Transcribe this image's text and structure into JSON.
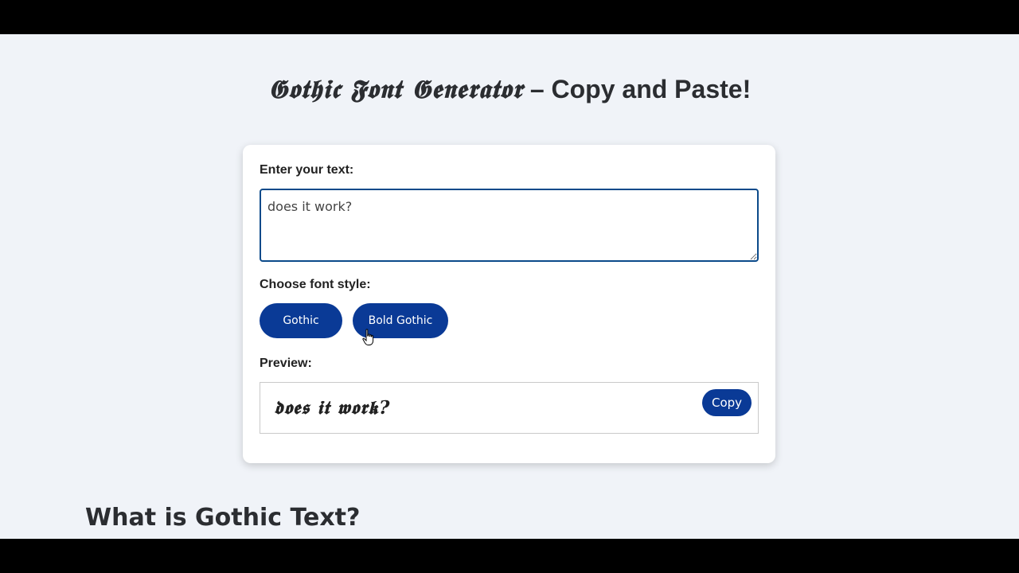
{
  "page": {
    "title_gothic": "𝕲𝖔𝖙𝖍𝖎𝖈 𝕱𝖔𝖓𝖙 𝕲𝖊𝖓𝖊𝖗𝖆𝖙𝖔𝖗",
    "title_rest": " – Copy and Paste!",
    "section_heading": "What is Gothic Text?"
  },
  "form": {
    "input_label": "Enter your text:",
    "input_value": "does it work?",
    "style_label": "Choose font style:",
    "styles": [
      {
        "label": "Gothic"
      },
      {
        "label": "Bold Gothic"
      }
    ],
    "preview_label": "Preview:",
    "preview_text": "𝖉𝖔𝖊𝖘 𝖎𝖙 𝖜𝖔𝖗𝖐?",
    "copy_label": "Copy"
  },
  "colors": {
    "background": "#f0f3f8",
    "accent": "#0a3a96",
    "input_border": "#0b4a8a",
    "text": "#2b2d31"
  },
  "icons": {
    "cursor": "hand-pointer-icon"
  }
}
